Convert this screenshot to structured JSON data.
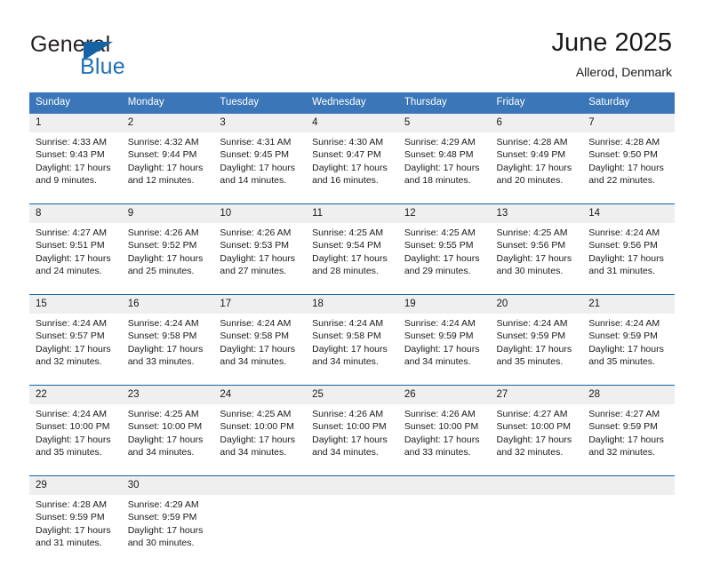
{
  "brand": {
    "word_one": "General",
    "word_two": "Blue",
    "triangle_icon": "blue-triangle-icon",
    "blue": "#1464a5",
    "dark": "#231f20"
  },
  "header": {
    "title": "June 2025",
    "location": "Allerod, Denmark",
    "accent": "#3a76b8"
  },
  "calendar": {
    "weekday_headers": [
      "Sunday",
      "Monday",
      "Tuesday",
      "Wednesday",
      "Thursday",
      "Friday",
      "Saturday"
    ],
    "labels": {
      "sunrise": "Sunrise:",
      "sunset": "Sunset:",
      "daylight": "Daylight:"
    },
    "weeks": [
      {
        "days": [
          {
            "num": "1",
            "sunrise": "Sunrise: 4:33 AM",
            "sunset": "Sunset: 9:43 PM",
            "daylight": "Daylight: 17 hours and 9 minutes."
          },
          {
            "num": "2",
            "sunrise": "Sunrise: 4:32 AM",
            "sunset": "Sunset: 9:44 PM",
            "daylight": "Daylight: 17 hours and 12 minutes."
          },
          {
            "num": "3",
            "sunrise": "Sunrise: 4:31 AM",
            "sunset": "Sunset: 9:45 PM",
            "daylight": "Daylight: 17 hours and 14 minutes."
          },
          {
            "num": "4",
            "sunrise": "Sunrise: 4:30 AM",
            "sunset": "Sunset: 9:47 PM",
            "daylight": "Daylight: 17 hours and 16 minutes."
          },
          {
            "num": "5",
            "sunrise": "Sunrise: 4:29 AM",
            "sunset": "Sunset: 9:48 PM",
            "daylight": "Daylight: 17 hours and 18 minutes."
          },
          {
            "num": "6",
            "sunrise": "Sunrise: 4:28 AM",
            "sunset": "Sunset: 9:49 PM",
            "daylight": "Daylight: 17 hours and 20 minutes."
          },
          {
            "num": "7",
            "sunrise": "Sunrise: 4:28 AM",
            "sunset": "Sunset: 9:50 PM",
            "daylight": "Daylight: 17 hours and 22 minutes."
          }
        ]
      },
      {
        "days": [
          {
            "num": "8",
            "sunrise": "Sunrise: 4:27 AM",
            "sunset": "Sunset: 9:51 PM",
            "daylight": "Daylight: 17 hours and 24 minutes."
          },
          {
            "num": "9",
            "sunrise": "Sunrise: 4:26 AM",
            "sunset": "Sunset: 9:52 PM",
            "daylight": "Daylight: 17 hours and 25 minutes."
          },
          {
            "num": "10",
            "sunrise": "Sunrise: 4:26 AM",
            "sunset": "Sunset: 9:53 PM",
            "daylight": "Daylight: 17 hours and 27 minutes."
          },
          {
            "num": "11",
            "sunrise": "Sunrise: 4:25 AM",
            "sunset": "Sunset: 9:54 PM",
            "daylight": "Daylight: 17 hours and 28 minutes."
          },
          {
            "num": "12",
            "sunrise": "Sunrise: 4:25 AM",
            "sunset": "Sunset: 9:55 PM",
            "daylight": "Daylight: 17 hours and 29 minutes."
          },
          {
            "num": "13",
            "sunrise": "Sunrise: 4:25 AM",
            "sunset": "Sunset: 9:56 PM",
            "daylight": "Daylight: 17 hours and 30 minutes."
          },
          {
            "num": "14",
            "sunrise": "Sunrise: 4:24 AM",
            "sunset": "Sunset: 9:56 PM",
            "daylight": "Daylight: 17 hours and 31 minutes."
          }
        ]
      },
      {
        "days": [
          {
            "num": "15",
            "sunrise": "Sunrise: 4:24 AM",
            "sunset": "Sunset: 9:57 PM",
            "daylight": "Daylight: 17 hours and 32 minutes."
          },
          {
            "num": "16",
            "sunrise": "Sunrise: 4:24 AM",
            "sunset": "Sunset: 9:58 PM",
            "daylight": "Daylight: 17 hours and 33 minutes."
          },
          {
            "num": "17",
            "sunrise": "Sunrise: 4:24 AM",
            "sunset": "Sunset: 9:58 PM",
            "daylight": "Daylight: 17 hours and 34 minutes."
          },
          {
            "num": "18",
            "sunrise": "Sunrise: 4:24 AM",
            "sunset": "Sunset: 9:58 PM",
            "daylight": "Daylight: 17 hours and 34 minutes."
          },
          {
            "num": "19",
            "sunrise": "Sunrise: 4:24 AM",
            "sunset": "Sunset: 9:59 PM",
            "daylight": "Daylight: 17 hours and 34 minutes."
          },
          {
            "num": "20",
            "sunrise": "Sunrise: 4:24 AM",
            "sunset": "Sunset: 9:59 PM",
            "daylight": "Daylight: 17 hours and 35 minutes."
          },
          {
            "num": "21",
            "sunrise": "Sunrise: 4:24 AM",
            "sunset": "Sunset: 9:59 PM",
            "daylight": "Daylight: 17 hours and 35 minutes."
          }
        ]
      },
      {
        "days": [
          {
            "num": "22",
            "sunrise": "Sunrise: 4:24 AM",
            "sunset": "Sunset: 10:00 PM",
            "daylight": "Daylight: 17 hours and 35 minutes."
          },
          {
            "num": "23",
            "sunrise": "Sunrise: 4:25 AM",
            "sunset": "Sunset: 10:00 PM",
            "daylight": "Daylight: 17 hours and 34 minutes."
          },
          {
            "num": "24",
            "sunrise": "Sunrise: 4:25 AM",
            "sunset": "Sunset: 10:00 PM",
            "daylight": "Daylight: 17 hours and 34 minutes."
          },
          {
            "num": "25",
            "sunrise": "Sunrise: 4:26 AM",
            "sunset": "Sunset: 10:00 PM",
            "daylight": "Daylight: 17 hours and 34 minutes."
          },
          {
            "num": "26",
            "sunrise": "Sunrise: 4:26 AM",
            "sunset": "Sunset: 10:00 PM",
            "daylight": "Daylight: 17 hours and 33 minutes."
          },
          {
            "num": "27",
            "sunrise": "Sunrise: 4:27 AM",
            "sunset": "Sunset: 10:00 PM",
            "daylight": "Daylight: 17 hours and 32 minutes."
          },
          {
            "num": "28",
            "sunrise": "Sunrise: 4:27 AM",
            "sunset": "Sunset: 9:59 PM",
            "daylight": "Daylight: 17 hours and 32 minutes."
          }
        ]
      },
      {
        "days": [
          {
            "num": "29",
            "sunrise": "Sunrise: 4:28 AM",
            "sunset": "Sunset: 9:59 PM",
            "daylight": "Daylight: 17 hours and 31 minutes."
          },
          {
            "num": "30",
            "sunrise": "Sunrise: 4:29 AM",
            "sunset": "Sunset: 9:59 PM",
            "daylight": "Daylight: 17 hours and 30 minutes."
          },
          {
            "num": "",
            "sunrise": "",
            "sunset": "",
            "daylight": ""
          },
          {
            "num": "",
            "sunrise": "",
            "sunset": "",
            "daylight": ""
          },
          {
            "num": "",
            "sunrise": "",
            "sunset": "",
            "daylight": ""
          },
          {
            "num": "",
            "sunrise": "",
            "sunset": "",
            "daylight": ""
          },
          {
            "num": "",
            "sunrise": "",
            "sunset": "",
            "daylight": ""
          }
        ]
      }
    ]
  }
}
